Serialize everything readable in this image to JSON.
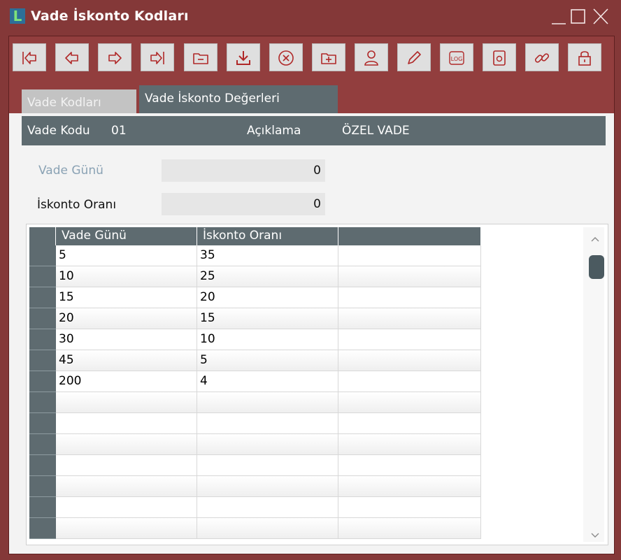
{
  "window": {
    "title": "Vade İskonto Kodları",
    "logo_letter": "L",
    "controls": [
      "minimize-icon",
      "maximize-icon",
      "close-icon"
    ]
  },
  "toolbar": {
    "buttons": [
      {
        "name": "first-record",
        "icon": "first-record-icon"
      },
      {
        "name": "previous-record",
        "icon": "previous-record-icon"
      },
      {
        "name": "next-record",
        "icon": "next-record-icon"
      },
      {
        "name": "last-record",
        "icon": "last-record-icon"
      },
      {
        "name": "folder",
        "icon": "folder-icon"
      },
      {
        "name": "save",
        "icon": "download-icon"
      },
      {
        "name": "cancel",
        "icon": "cancel-icon"
      },
      {
        "name": "new",
        "icon": "new-folder-icon"
      },
      {
        "name": "user",
        "icon": "user-icon"
      },
      {
        "name": "edit",
        "icon": "pencil-icon"
      },
      {
        "name": "log",
        "icon": "log-icon",
        "label": "LOG"
      },
      {
        "name": "attachment",
        "icon": "attachment-icon"
      },
      {
        "name": "link",
        "icon": "link-icon"
      },
      {
        "name": "lock",
        "icon": "lock-icon"
      }
    ]
  },
  "tabs": [
    {
      "label": "Vade Kodları",
      "active": false
    },
    {
      "label": "Vade İskonto Değerleri",
      "active": true
    }
  ],
  "info": {
    "code_label": "Vade Kodu",
    "code_value": "01",
    "desc_label": "Açıklama",
    "desc_value": "ÖZEL VADE"
  },
  "form": {
    "vade_gunu": {
      "label": "Vade Günü",
      "value": "0"
    },
    "iskonto_orani": {
      "label": "İskonto Oranı",
      "value": "0"
    }
  },
  "table": {
    "columns": [
      "Vade Günü",
      "İskonto Oranı",
      ""
    ],
    "rows": [
      [
        "5",
        "35",
        ""
      ],
      [
        "10",
        "25",
        ""
      ],
      [
        "15",
        "20",
        ""
      ],
      [
        "20",
        "15",
        ""
      ],
      [
        "30",
        "10",
        ""
      ],
      [
        "45",
        "5",
        ""
      ],
      [
        "200",
        "4",
        ""
      ],
      [
        "",
        "",
        ""
      ],
      [
        "",
        "",
        ""
      ],
      [
        "",
        "",
        ""
      ],
      [
        "",
        "",
        ""
      ],
      [
        "",
        "",
        ""
      ],
      [
        "",
        "",
        ""
      ],
      [
        "",
        "",
        ""
      ]
    ]
  },
  "colors": {
    "frame": "#843838",
    "toolbar_bg": "#923e3e",
    "header_slate": "#5e6b70",
    "icon_red": "#b02828"
  }
}
